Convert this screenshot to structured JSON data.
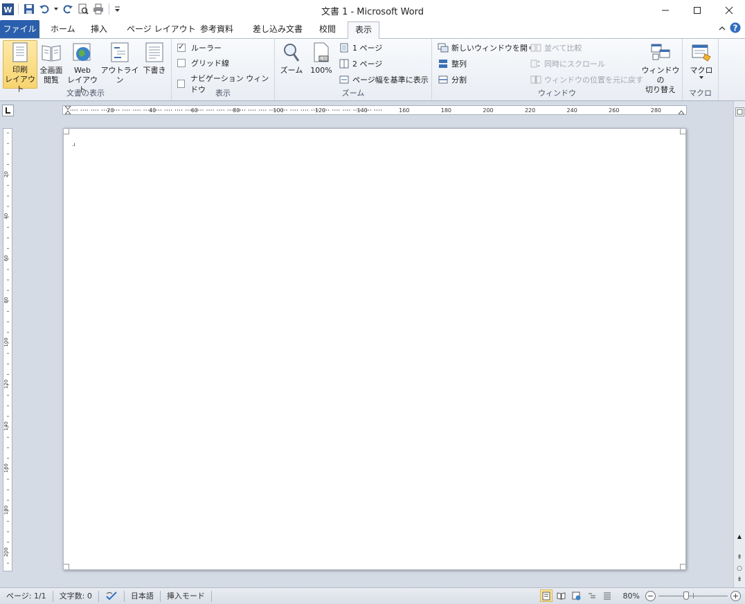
{
  "window": {
    "title": "文書 1 - Microsoft Word"
  },
  "tabs": [
    {
      "label": "ファイル"
    },
    {
      "label": "ホーム"
    },
    {
      "label": "挿入"
    },
    {
      "label": "ページ レイアウト"
    },
    {
      "label": "参考資料"
    },
    {
      "label": "差し込み文書"
    },
    {
      "label": "校閲"
    },
    {
      "label": "表示"
    }
  ],
  "ribbon": {
    "document_views": {
      "label": "文書の表示",
      "print_layout": "印刷\nレイアウト",
      "full_screen": "全画面\n閲覧",
      "web_layout": "Web\nレイアウト",
      "outline": "アウトライン",
      "draft": "下書き"
    },
    "show": {
      "label": "表示",
      "ruler": "ルーラー",
      "gridlines": "グリッド線",
      "navigation": "ナビゲーション ウィンドウ"
    },
    "zoom": {
      "label": "ズーム",
      "zoom": "ズーム",
      "hundred": "100%",
      "one_page": "1 ページ",
      "two_pages": "2 ページ",
      "page_width": "ページ幅を基準に表示"
    },
    "window": {
      "label": "ウィンドウ",
      "new_window": "新しいウィンドウを開く",
      "arrange": "整列",
      "split": "分割",
      "side_by_side": "並べて比較",
      "sync_scroll": "同時にスクロール",
      "reset_position": "ウィンドウの位置を元に戻す",
      "switch_windows": "ウィンドウの\n切り替え"
    },
    "macros": {
      "label": "マクロ",
      "macros": "マクロ"
    }
  },
  "ruler": {
    "h_labels": [
      "20",
      "40",
      "60",
      "80",
      "100",
      "120",
      "140",
      "160",
      "180",
      "200",
      "220",
      "240",
      "260",
      "280"
    ],
    "v_labels": [
      "20",
      "40",
      "60",
      "80",
      "100",
      "120",
      "140",
      "160",
      "180",
      "200"
    ]
  },
  "status": {
    "page": "ページ: 1/1",
    "words": "文字数: 0",
    "language": "日本語",
    "mode": "挿入モード",
    "zoom": "80%",
    "zoom_level": 0.8
  }
}
